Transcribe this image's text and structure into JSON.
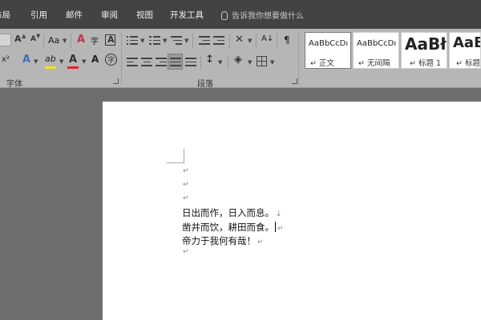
{
  "tabs": [
    {
      "label": "布局"
    },
    {
      "label": "引用"
    },
    {
      "label": "邮件"
    },
    {
      "label": "审阅"
    },
    {
      "label": "视图"
    },
    {
      "label": "开发工具"
    }
  ],
  "tell_me": {
    "placeholder": "告诉我你想要做什么"
  },
  "font_group": {
    "label": "字体",
    "grow_font": "A",
    "shrink_font": "A",
    "change_case": "Aa",
    "clear_format": "A",
    "phonetic": "字",
    "char_border": "A",
    "superscript": "x²",
    "text_effects": "A",
    "highlight_letter": "ab",
    "font_color_letter": "A",
    "char_shading": "A",
    "enclose_char": "字",
    "highlight_color": "#f4e21b",
    "font_color": "#e0262b"
  },
  "paragraph_group": {
    "label": "段落",
    "sort_label": "A↓",
    "pilcrow": "¶",
    "line_spacing": "↕"
  },
  "styles": [
    {
      "sample": "AaBbCcDı",
      "name": "正文"
    },
    {
      "sample": "AaBbCcDı",
      "name": "无间隔"
    },
    {
      "sample": "AaBł",
      "name": "标题 1"
    },
    {
      "sample": "AaBl",
      "name": "标题 2"
    }
  ],
  "document": {
    "lines": [
      {
        "text": "日出而作，日入而息。",
        "mark": "↓"
      },
      {
        "text": "凿井而饮，耕田而食。",
        "mark": "↵"
      },
      {
        "text": "帝力于我何有哉！",
        "mark": "↵"
      }
    ],
    "empty_mark": "↵"
  }
}
